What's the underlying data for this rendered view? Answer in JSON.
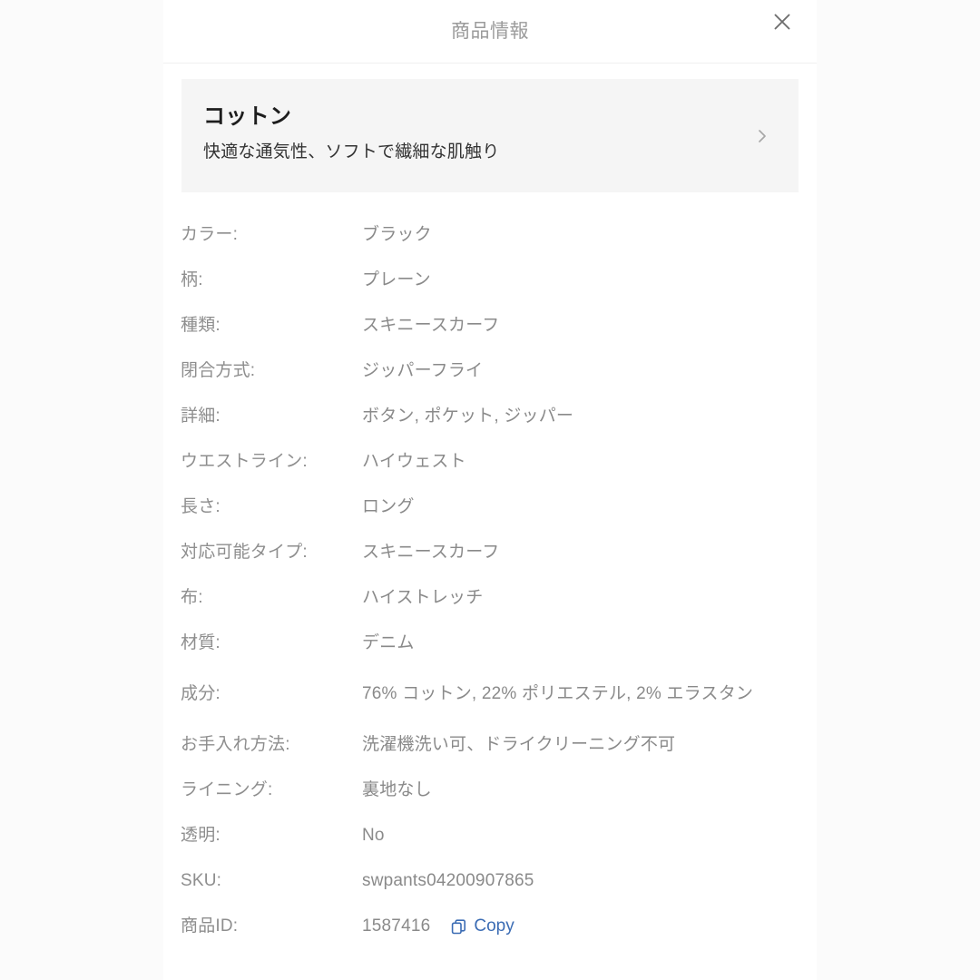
{
  "header": {
    "title": "商品情報",
    "close_icon": "close-icon"
  },
  "material_card": {
    "name": "コットン",
    "description": "快適な通気性、ソフトで繊細な肌触り",
    "chevron_icon": "chevron-right-icon"
  },
  "specs": [
    {
      "label": "カラー:",
      "value": "ブラック"
    },
    {
      "label": "柄:",
      "value": "プレーン"
    },
    {
      "label": "種類:",
      "value": "スキニースカーフ"
    },
    {
      "label": "閉合方式:",
      "value": "ジッパーフライ"
    },
    {
      "label": "詳細:",
      "value": "ボタン, ポケット, ジッパー"
    },
    {
      "label": "ウエストライン:",
      "value": "ハイウェスト"
    },
    {
      "label": "長さ:",
      "value": "ロング"
    },
    {
      "label": "対応可能タイプ:",
      "value": "スキニースカーフ"
    },
    {
      "label": "布:",
      "value": "ハイストレッチ"
    },
    {
      "label": "材質:",
      "value": "デニム"
    },
    {
      "label": "成分:",
      "value": "76% コットン, 22% ポリエステル, 2% エラスタン"
    },
    {
      "label": "お手入れ方法:",
      "value": "洗濯機洗い可、ドライクリーニング不可"
    },
    {
      "label": "ライニング:",
      "value": "裏地なし"
    },
    {
      "label": "透明:",
      "value": "No"
    },
    {
      "label": "SKU:",
      "value": "swpants04200907865"
    }
  ],
  "product_id_row": {
    "label": "商品ID:",
    "value": "1587416",
    "copy_label": "Copy",
    "copy_icon": "copy-icon"
  },
  "colors": {
    "page_background": "#fbfbfb",
    "modal_background": "#ffffff",
    "card_background": "#f5f5f5",
    "title_text": "#9b9b9b",
    "label_text": "#8e8e8e",
    "value_text": "#8a8a8a",
    "material_name_text": "#1d1d1d",
    "link_blue": "#3b6cb4",
    "divider": "#f0f0f0"
  }
}
